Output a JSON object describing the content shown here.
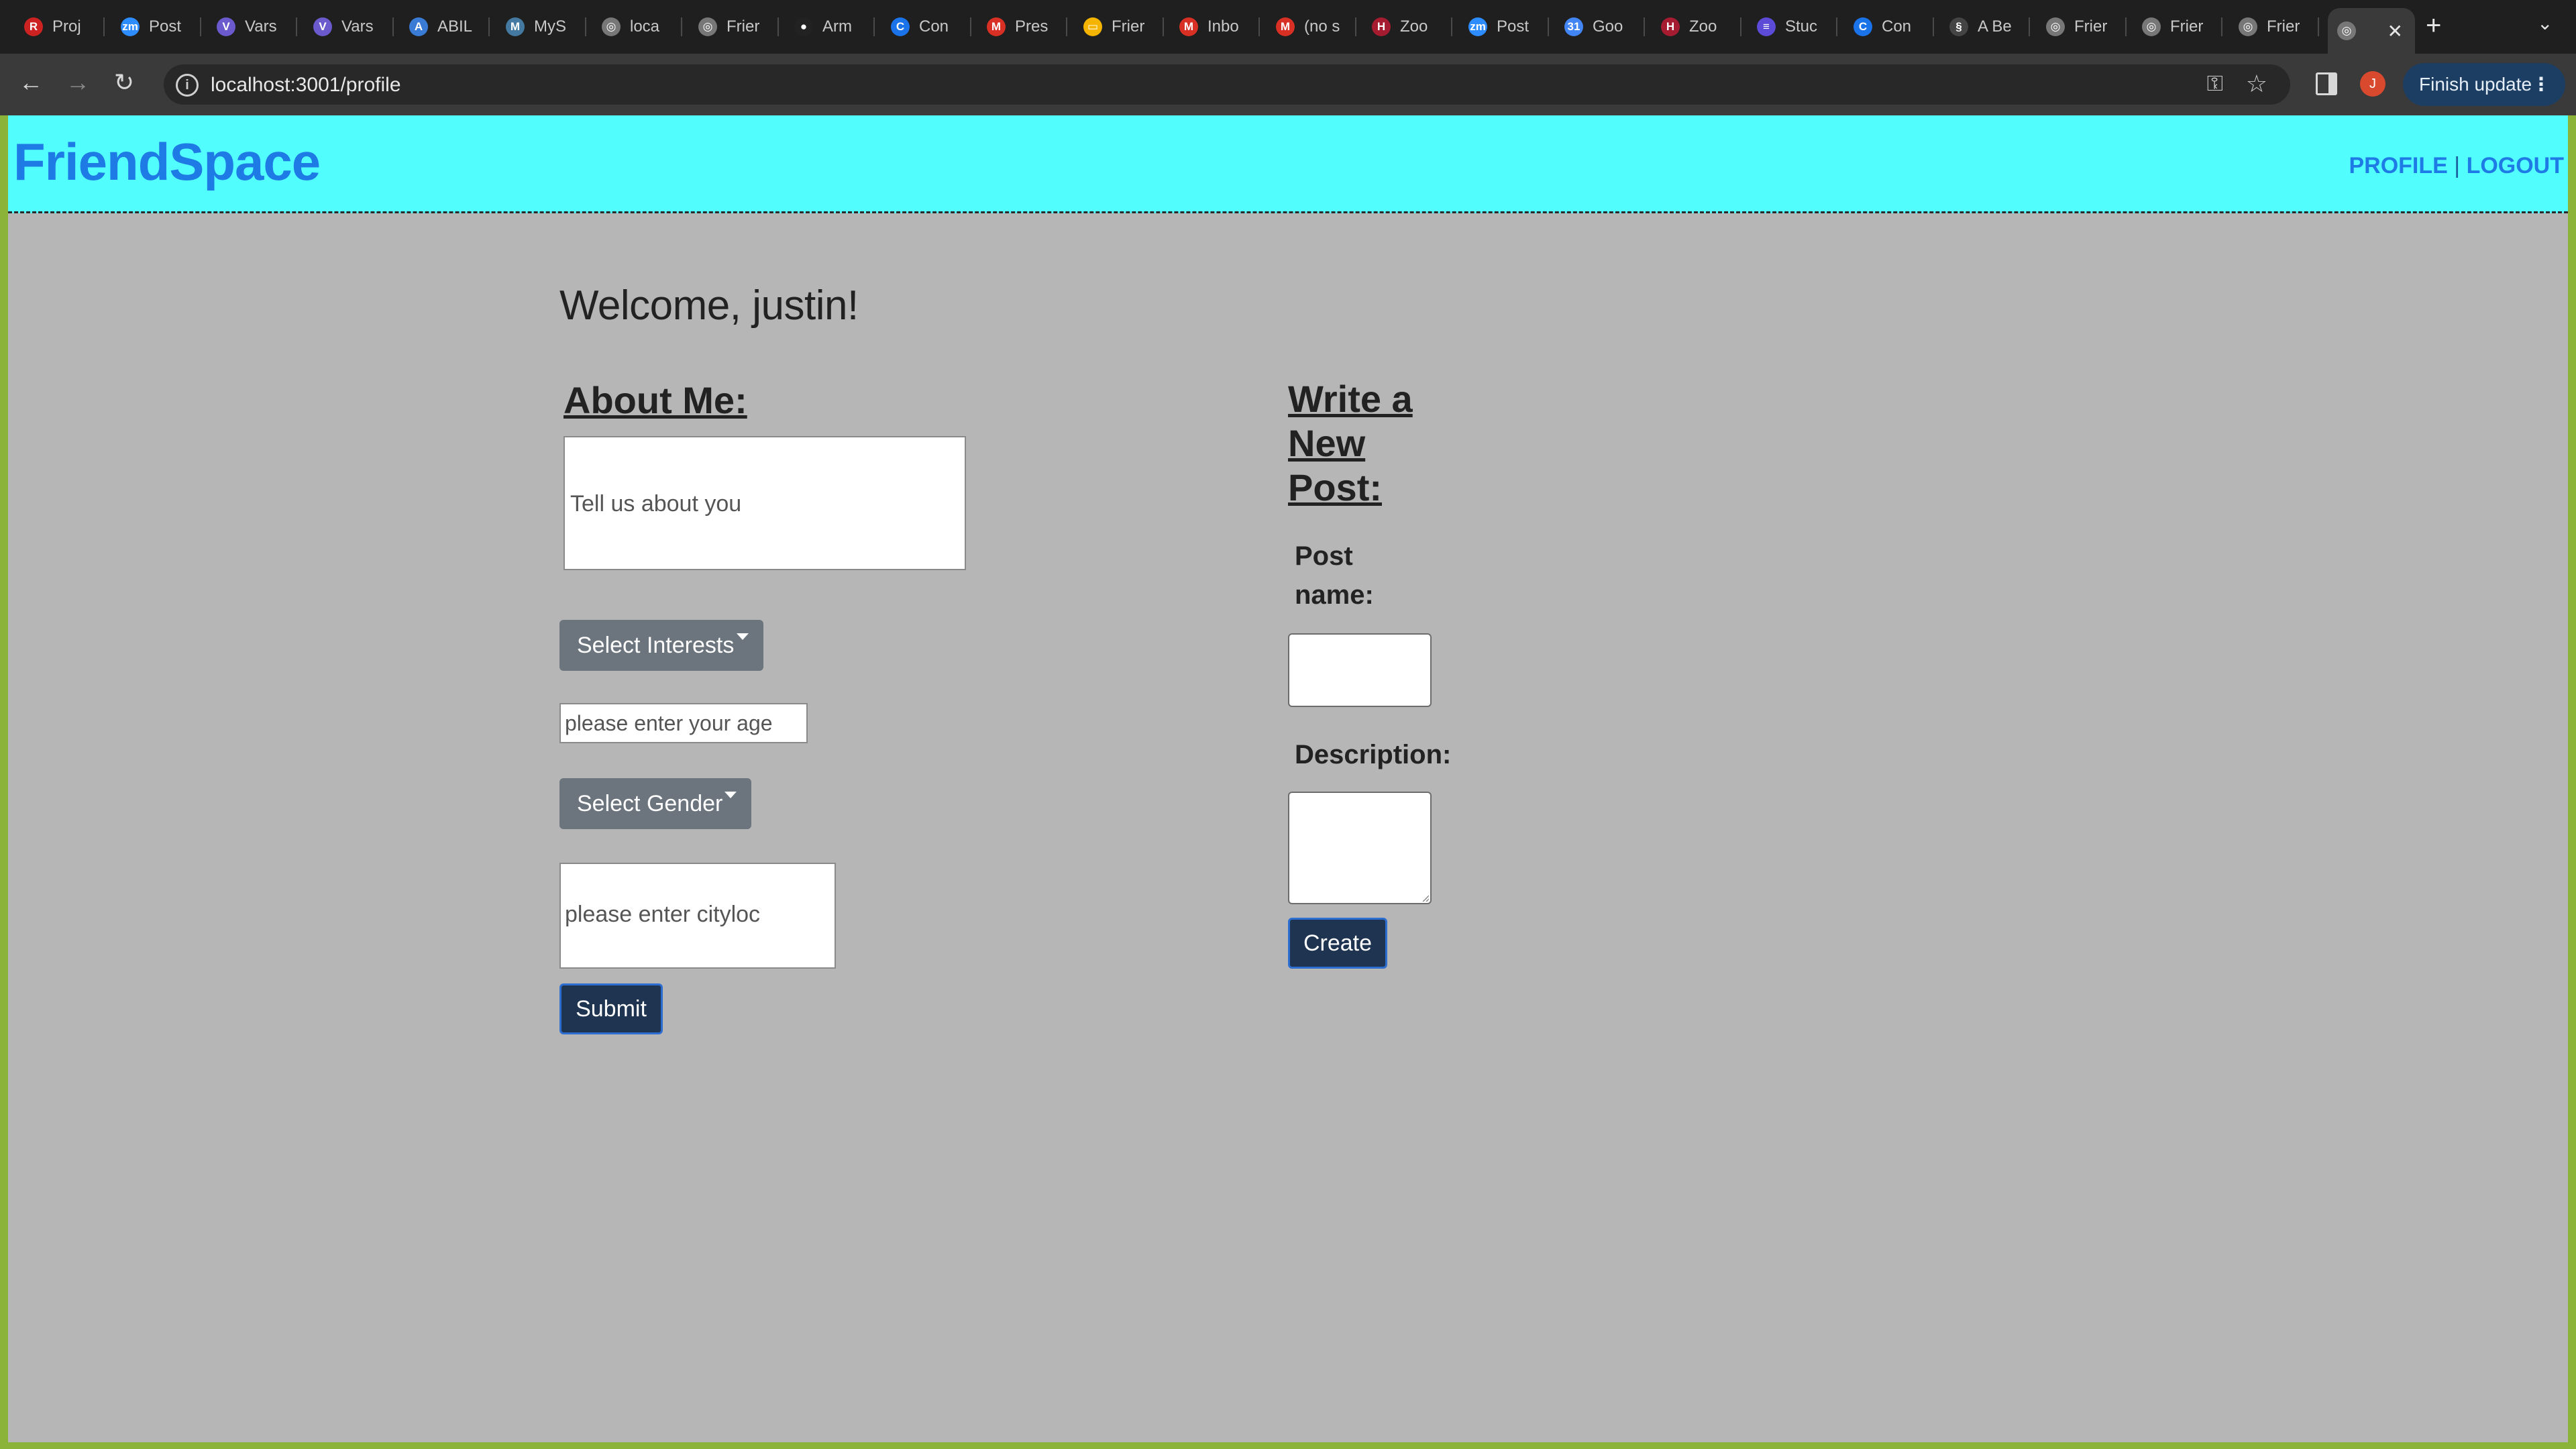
{
  "browser": {
    "tabs": [
      {
        "title": "Proj",
        "icon": "rutgers-icon",
        "color": "#cc2222",
        "glyph": "R"
      },
      {
        "title": "Post",
        "icon": "zoom-icon",
        "color": "#2d8cff",
        "glyph": "zm"
      },
      {
        "title": "Vars",
        "icon": "varsity-icon",
        "color": "#6a5acd",
        "glyph": "V"
      },
      {
        "title": "Vars",
        "icon": "varsity-icon",
        "color": "#6a5acd",
        "glyph": "V"
      },
      {
        "title": "ABIL",
        "icon": "abilities-icon",
        "color": "#3a7bd5",
        "glyph": "A"
      },
      {
        "title": "MyS",
        "icon": "mysql-icon",
        "color": "#4479a1",
        "glyph": "M"
      },
      {
        "title": "loca",
        "icon": "globe-icon",
        "color": "#777777",
        "glyph": "◎"
      },
      {
        "title": "Frier",
        "icon": "globe-icon",
        "color": "#777777",
        "glyph": "◎"
      },
      {
        "title": "Arm",
        "icon": "github-icon",
        "color": "#222222",
        "glyph": "●"
      },
      {
        "title": "Con",
        "icon": "chrome-icon",
        "color": "#1a73e8",
        "glyph": "C"
      },
      {
        "title": "Pres",
        "icon": "gmail-icon",
        "color": "#d93025",
        "glyph": "M"
      },
      {
        "title": "Frier",
        "icon": "slides-icon",
        "color": "#f4b400",
        "glyph": "▭"
      },
      {
        "title": "Inbo",
        "icon": "gmail-icon",
        "color": "#d93025",
        "glyph": "M"
      },
      {
        "title": "(no s",
        "icon": "gmail-icon",
        "color": "#d93025",
        "glyph": "M"
      },
      {
        "title": "Zoo",
        "icon": "harvard-icon",
        "color": "#a51c30",
        "glyph": "H"
      },
      {
        "title": "Post",
        "icon": "zoom-icon",
        "color": "#2d8cff",
        "glyph": "zm"
      },
      {
        "title": "Goo",
        "icon": "google-calendar-icon",
        "color": "#4285f4",
        "glyph": "31"
      },
      {
        "title": "Zoo",
        "icon": "harvard-icon",
        "color": "#a51c30",
        "glyph": "H"
      },
      {
        "title": "Stuc",
        "icon": "list-icon",
        "color": "#5b4bd6",
        "glyph": "≡"
      },
      {
        "title": "Con",
        "icon": "chrome-icon",
        "color": "#1a73e8",
        "glyph": "C"
      },
      {
        "title": "A Be",
        "icon": "link-icon",
        "color": "#444444",
        "glyph": "§"
      },
      {
        "title": "Frier",
        "icon": "globe-icon",
        "color": "#777777",
        "glyph": "◎"
      },
      {
        "title": "Frier",
        "icon": "globe-icon",
        "color": "#777777",
        "glyph": "◎"
      },
      {
        "title": "Frier",
        "icon": "globe-icon",
        "color": "#777777",
        "glyph": "◎"
      }
    ],
    "active_tab_close": "✕",
    "new_tab": "+",
    "url": "localhost:3001/profile",
    "update_label": "Finish update",
    "profile_initial": "J"
  },
  "site": {
    "brand": "FriendSpace",
    "nav_profile": "PROFILE",
    "nav_separator": "|",
    "nav_logout": "LOGOUT",
    "header_color": "#52fdfd",
    "brand_color": "#1e7be5"
  },
  "profile": {
    "welcome": "Welcome, justin!",
    "about_title": "About Me:",
    "about_placeholder": "Tell us about you",
    "interests_label": "Select Interests",
    "age_placeholder": "please enter your age",
    "gender_label": "Select Gender",
    "city_placeholder": "please enter cityloc",
    "submit_label": "Submit"
  },
  "post": {
    "title": "Write a New Post:",
    "name_label": "Post name:",
    "name_value": "",
    "description_label": "Description:",
    "description_value": "",
    "create_label": "Create"
  }
}
